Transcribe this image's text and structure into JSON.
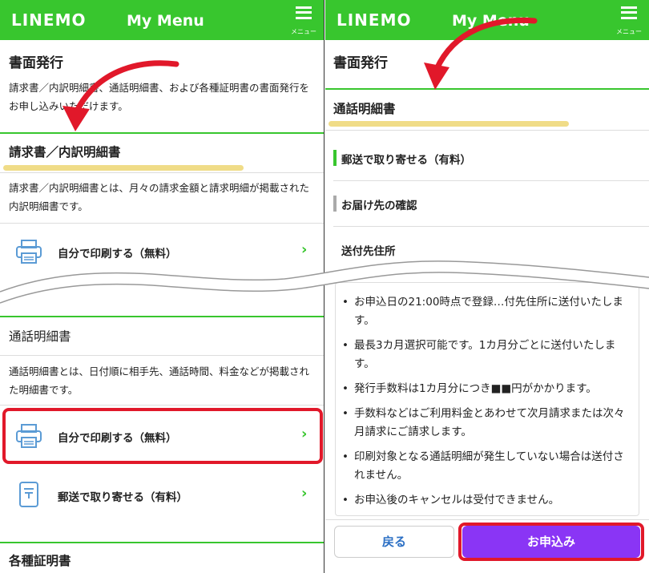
{
  "app": {
    "logo": "LINEMO",
    "title": "My Menu",
    "menu_label": "メニュー",
    "brand_green": "#38c62e",
    "accent_purple": "#8a35f5",
    "highlight_red": "#e1182a"
  },
  "left": {
    "section_title": "書面発行",
    "section_desc": "請求書／内訳明細書、通話明細書、および各種証明書の書面発行をお申し込みいただけます。",
    "invoice": {
      "title": "請求書／内訳明細書",
      "desc": "請求書／内訳明細書とは、月々の請求金額と請求明細が掲載された内訳明細書です。",
      "print_label": "自分で印刷する（無料）"
    },
    "call": {
      "title": "通話明細書",
      "desc": "通話明細書とは、日付順に相手先、通話時間、料金などが掲載された明細書です。",
      "print_label": "自分で印刷する（無料）",
      "mail_label": "郵送で取り寄せる（有料）"
    },
    "certificates_title": "各種証明書"
  },
  "right": {
    "section_title": "書面発行",
    "subsection_title": "通話明細書",
    "mail_heading": "郵送で取り寄せる（有料）",
    "delivery_check": "お届け先の確認",
    "address_label": "送付先住所",
    "notes": [
      "お申込日の21:00時点で登録…付先住所に送付いたします。",
      "最長3カ月選択可能です。1カ月分ごとに送付いたします。",
      "発行手数料は1カ月分につき■■円がかかります。",
      "手数料などはご利用料金とあわせて次月請求または次々月請求にご請求します。",
      "印刷対象となる通話明細が発生していない場合は送付されません。",
      "お申込後のキャンセルは受付できません。"
    ],
    "back_label": "戻る",
    "apply_label": "お申込み"
  },
  "icons": {
    "print": "printer-icon",
    "mail": "mailbox-icon",
    "chevron": "chevron-right-icon",
    "menu": "hamburger-menu-icon",
    "arrow": "red-curved-arrow"
  }
}
